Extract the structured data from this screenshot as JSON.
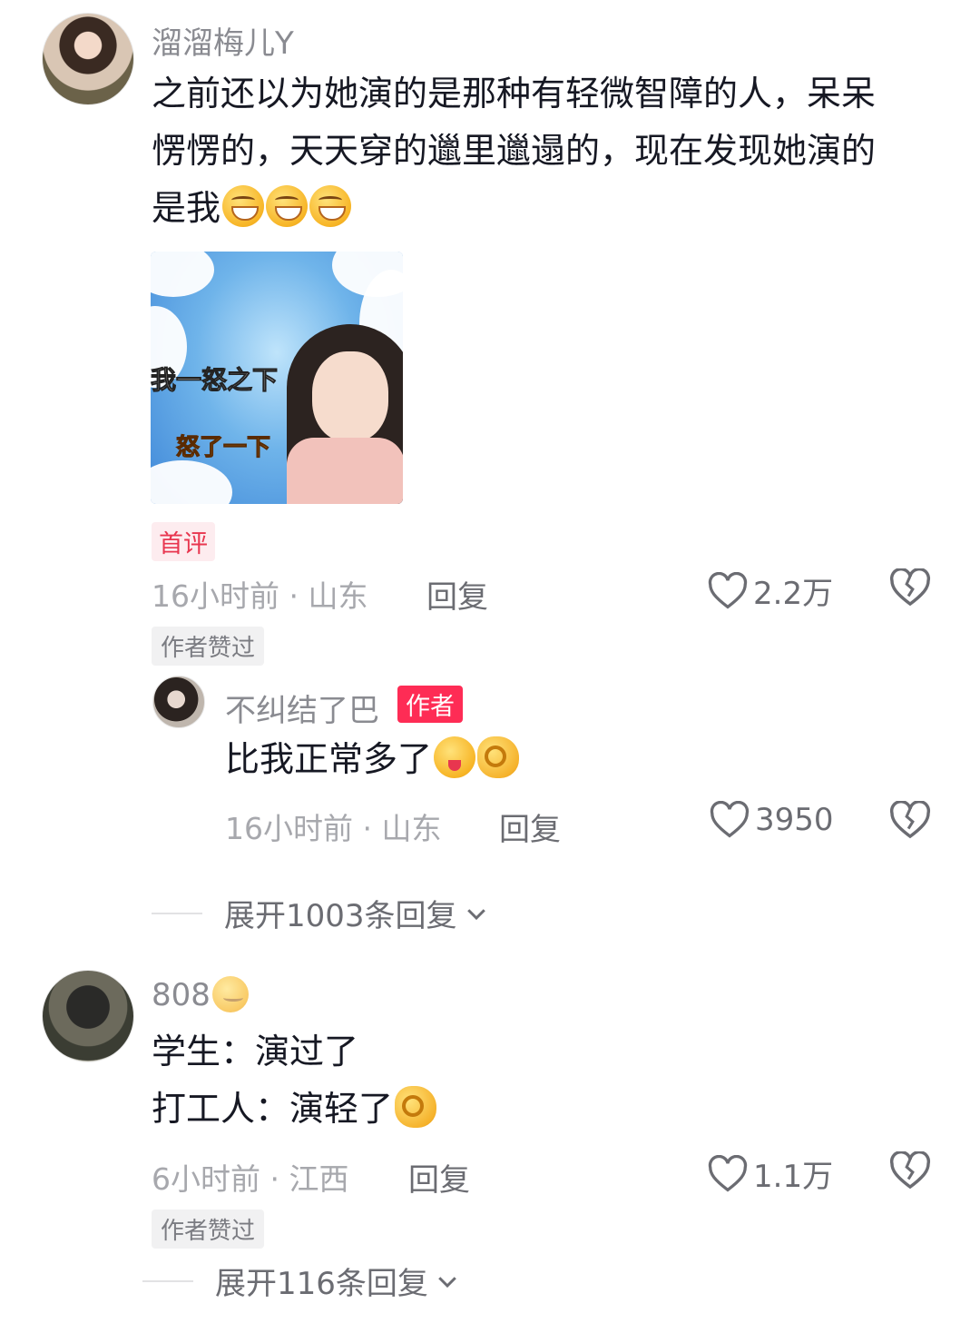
{
  "colors": {
    "accent": "#fe2c55",
    "text": "#161823",
    "muted": "#a7a8ad"
  },
  "comments": [
    {
      "username": "溜溜梅儿Y",
      "text_lines": [
        "之前还以为她演的是那种有轻微智障的人，呆呆",
        "愣愣的，天天穿的邋里邋遢的，现在发现她演的",
        "是我"
      ],
      "emoji": [
        "grinning-emoji",
        "grinning-emoji",
        "grinning-emoji"
      ],
      "image": {
        "caption_1": "我一怒之下",
        "caption_2": "怒了一下"
      },
      "first_tag": "首评",
      "time_location": "16小时前 · 山东",
      "reply_label": "回复",
      "likes": "2.2万",
      "author_liked": "作者赞过",
      "replies": [
        {
          "username": "不纠结了巴",
          "author_tag": "作者",
          "text": "比我正常多了",
          "emoji": [
            "wink-tongue-emoji",
            "ok-hand-emoji"
          ],
          "time_location": "16小时前 · 山东",
          "reply_label": "回复",
          "likes": "3950"
        }
      ],
      "expand_label": "展开1003条回复"
    },
    {
      "username": "808",
      "username_emoji": "sleeping-emoji",
      "text_lines": [
        "学生：演过了",
        "打工人：演轻了"
      ],
      "emoji": [
        "ok-hand-emoji"
      ],
      "time_location": "6小时前 · 江西",
      "reply_label": "回复",
      "likes": "1.1万",
      "author_liked": "作者赞过",
      "expand_label": "展开116条回复"
    }
  ]
}
